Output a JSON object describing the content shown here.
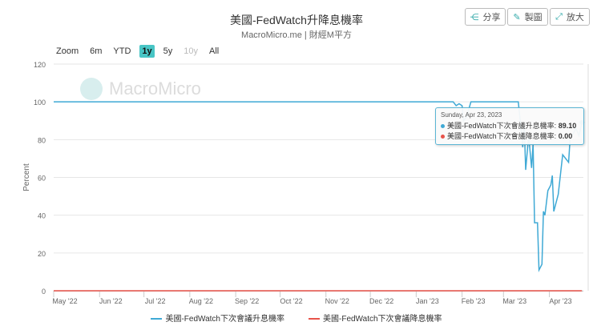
{
  "header": {
    "title": "美國-FedWatch升降息機率",
    "subtitle": "MacroMicro.me | 財經M平方",
    "share": "分享",
    "draw": "製圖",
    "expand": "放大"
  },
  "zoom": {
    "label": "Zoom",
    "options": [
      "6m",
      "YTD",
      "1y",
      "5y",
      "10y",
      "All"
    ],
    "active": "1y"
  },
  "watermark": "MacroMicro",
  "tooltip": {
    "date": "Sunday, Apr 23, 2023",
    "rows": [
      {
        "label": "美國-FedWatch下次會議升息機率:",
        "value": "89.10"
      },
      {
        "label": "美國-FedWatch下次會議降息機率:",
        "value": "0.00"
      }
    ]
  },
  "chart_data": {
    "type": "line",
    "title": "美國-FedWatch升降息機率",
    "ylabel": "Percent",
    "ylim": [
      0,
      120
    ],
    "yticks": [
      0,
      20,
      40,
      60,
      80,
      100,
      120
    ],
    "xlim": [
      "2022-05-01",
      "2023-04-24"
    ],
    "xticks": [
      {
        "label": "May '22",
        "date": "2022-05-01"
      },
      {
        "label": "Jun '22",
        "date": "2022-06-01"
      },
      {
        "label": "Jul '22",
        "date": "2022-07-01"
      },
      {
        "label": "Aug '22",
        "date": "2022-08-01"
      },
      {
        "label": "Sep '22",
        "date": "2022-09-01"
      },
      {
        "label": "Oct '22",
        "date": "2022-10-01"
      },
      {
        "label": "Nov '22",
        "date": "2022-11-01"
      },
      {
        "label": "Dec '22",
        "date": "2022-12-01"
      },
      {
        "label": "Jan '23",
        "date": "2023-01-01"
      },
      {
        "label": "Feb '23",
        "date": "2023-02-01"
      },
      {
        "label": "Mar '23",
        "date": "2023-03-01"
      },
      {
        "label": "Apr '23",
        "date": "2023-04-01"
      }
    ],
    "grid": true,
    "legend": "bottom",
    "series": [
      {
        "name": "美國-FedWatch下次會議升息機率",
        "color": "#3fa9d5",
        "points": [
          [
            "2022-05-01",
            100
          ],
          [
            "2023-01-26",
            100
          ],
          [
            "2023-01-28",
            98
          ],
          [
            "2023-01-30",
            99
          ],
          [
            "2023-02-01",
            98
          ],
          [
            "2023-02-02",
            90
          ],
          [
            "2023-02-04",
            92
          ],
          [
            "2023-02-07",
            100
          ],
          [
            "2023-03-11",
            100
          ],
          [
            "2023-03-13",
            85
          ],
          [
            "2023-03-14",
            76
          ],
          [
            "2023-03-15",
            88
          ],
          [
            "2023-03-16",
            64
          ],
          [
            "2023-03-18",
            82
          ],
          [
            "2023-03-20",
            65
          ],
          [
            "2023-03-21",
            78
          ],
          [
            "2023-03-22",
            36
          ],
          [
            "2023-03-24",
            36
          ],
          [
            "2023-03-25",
            11
          ],
          [
            "2023-03-27",
            14
          ],
          [
            "2023-03-28",
            42
          ],
          [
            "2023-03-29",
            40
          ],
          [
            "2023-03-31",
            53
          ],
          [
            "2023-04-02",
            56
          ],
          [
            "2023-04-03",
            61
          ],
          [
            "2023-04-04",
            42
          ],
          [
            "2023-04-07",
            51
          ],
          [
            "2023-04-10",
            72
          ],
          [
            "2023-04-14",
            68
          ],
          [
            "2023-04-15",
            80
          ],
          [
            "2023-04-19",
            86
          ],
          [
            "2023-04-21",
            82
          ],
          [
            "2023-04-23",
            89.1
          ]
        ]
      },
      {
        "name": "美國-FedWatch下次會議降息機率",
        "color": "#e8534a",
        "points": [
          [
            "2022-05-01",
            0
          ],
          [
            "2023-04-23",
            0
          ]
        ]
      }
    ]
  }
}
